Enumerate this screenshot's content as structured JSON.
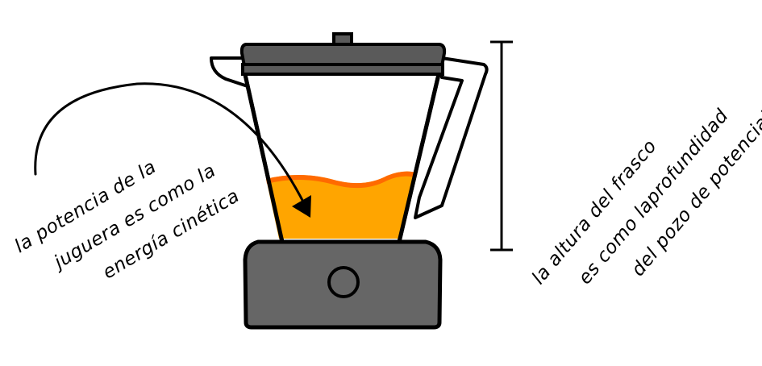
{
  "left_annotation": {
    "lines": [
      "la potencia de la",
      "juguera es como la",
      "energía cinética"
    ]
  },
  "right_annotation": {
    "lines": [
      "la altura del frasco",
      "es como laprofundidad",
      "del pozo de potencial"
    ]
  },
  "colors": {
    "outline": "#000000",
    "lid": "#5a5a5a",
    "base": "#666666",
    "juice": "#ffa500",
    "juice_top": "#ff6a00",
    "jar": "#ffffff"
  },
  "icons": {
    "knob": "knob-icon",
    "arrow": "curved-arrow-icon",
    "bracket": "height-bracket-icon"
  }
}
